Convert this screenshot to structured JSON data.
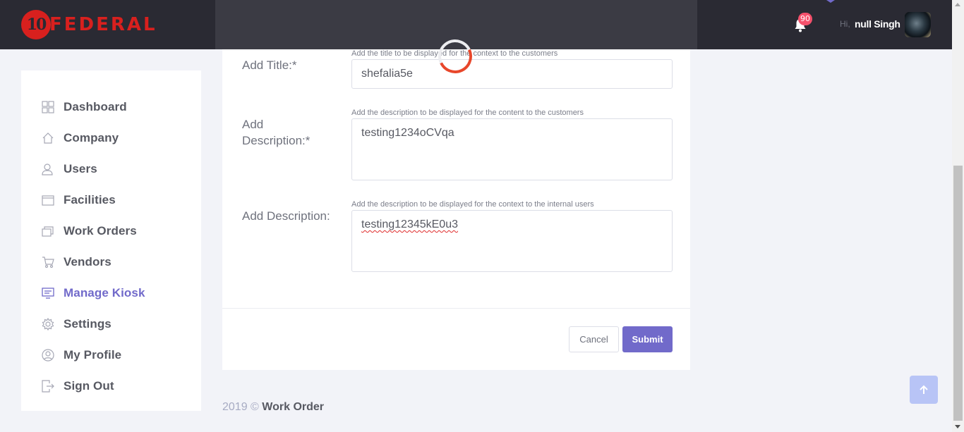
{
  "header": {
    "logo_number": "10",
    "logo_text": "FEDERAL",
    "notification_count": "90",
    "greeting": "Hi,",
    "username": "null Singh"
  },
  "sidebar": {
    "items": [
      {
        "label": "Dashboard",
        "icon": "dashboard-icon"
      },
      {
        "label": "Company",
        "icon": "home-icon"
      },
      {
        "label": "Users",
        "icon": "users-icon"
      },
      {
        "label": "Facilities",
        "icon": "facilities-icon"
      },
      {
        "label": "Work Orders",
        "icon": "work-orders-icon"
      },
      {
        "label": "Vendors",
        "icon": "cart-icon"
      },
      {
        "label": "Manage Kiosk",
        "icon": "kiosk-icon",
        "active": true
      },
      {
        "label": "Settings",
        "icon": "gear-icon"
      },
      {
        "label": "My Profile",
        "icon": "profile-icon"
      },
      {
        "label": "Sign Out",
        "icon": "sign-out-icon"
      }
    ]
  },
  "form": {
    "title_label": "Add Title:*",
    "title_hint": "Add the title to be displayed for the context to the customers",
    "title_value": "shefalia5e",
    "desc_label_line1": "Add",
    "desc_label_line2": "Description:*",
    "desc_hint": "Add the description to be displayed for the content to the customers",
    "desc_value": "testing1234oCVqa",
    "internal_label": "Add Description:",
    "internal_hint": "Add the description to be displayed for the context to the internal users",
    "internal_value": "testing12345kE0u3",
    "cancel_label": "Cancel",
    "submit_label": "Submit"
  },
  "footer": {
    "year": "2019 ©",
    "brand": "Work Order"
  },
  "colors": {
    "accent": "#716aca",
    "header_bg": "#2a2a33",
    "logo_red": "#d8201e",
    "badge": "#f4516c",
    "spinner": "#e8472b"
  }
}
